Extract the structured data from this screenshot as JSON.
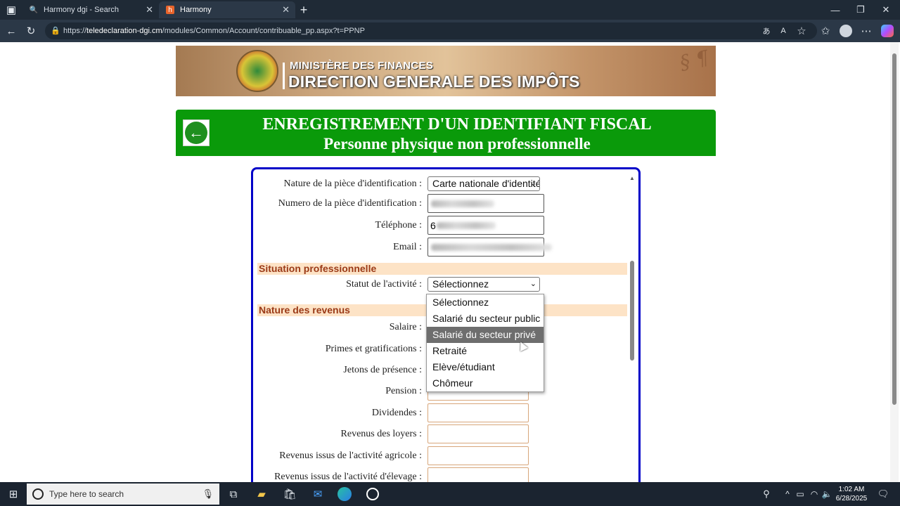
{
  "browser": {
    "tabs": [
      {
        "title": "Harmony dgi - Search",
        "icon": "search-icon"
      },
      {
        "title": "Harmony",
        "icon": "harmony-favicon"
      }
    ],
    "url_prefix": "https://",
    "url_domain": "teledeclaration-dgi.cm",
    "url_path": "/modules/Common/Account/contribuable_pp.aspx?t=PPNP"
  },
  "banner": {
    "ministry": "MINISTÈRE DES FINANCES",
    "direction": "DIRECTION GENERALE DES IMPÔTS"
  },
  "header": {
    "title": "ENREGISTREMENT D'UN IDENTIFIANT FISCAL",
    "subtitle": "Personne physique non professionnelle"
  },
  "form": {
    "id_type_label": "Nature de la pièce d'identification :",
    "id_type_value": "Carte nationale d'identité",
    "id_number_label": "Numero de la pièce d'identification :",
    "phone_label": "Téléphone :",
    "phone_value": "6",
    "email_label": "Email :",
    "section_situation": "Situation professionnelle",
    "activity_status_label": "Statut de l'activité :",
    "activity_status_value": "Sélectionnez",
    "section_revenus": "Nature des revenus",
    "salaire_label": "Salaire :",
    "primes_label": "Primes et gratifications :",
    "jetons_label": "Jetons de présence :",
    "pension_label": "Pension :",
    "dividendes_label": "Dividendes :",
    "loyers_label": "Revenus des loyers :",
    "agricole_label": "Revenus issus de l'activité agricole :",
    "elevage_label": "Revenus issus de l'activité d'élevage :"
  },
  "dropdown": {
    "options": [
      "Sélectionnez",
      "Salarié du secteur public",
      "Salarié du secteur privé",
      "Retraité",
      "Elève/étudiant",
      "Chômeur"
    ],
    "highlighted": "Salarié du secteur privé"
  },
  "taskbar": {
    "search_placeholder": "Type here to search",
    "time": "1:02 AM",
    "date": "6/28/2025"
  }
}
